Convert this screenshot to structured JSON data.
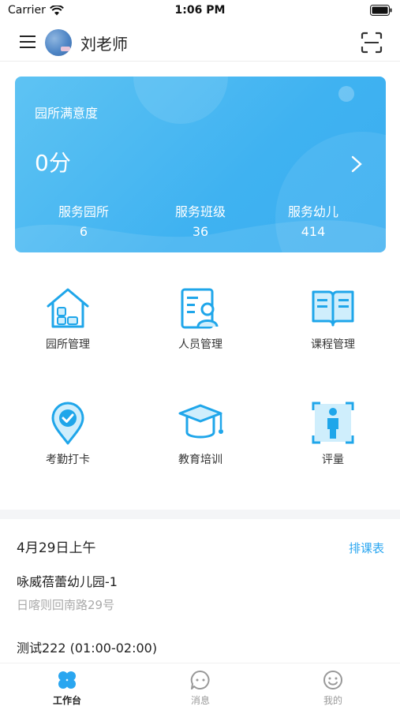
{
  "status_bar": {
    "carrier": "Carrier",
    "time": "1:06 PM"
  },
  "nav": {
    "title": "刘老师",
    "menu_icon": "menu-icon",
    "scan_icon": "scan-icon"
  },
  "satisfaction": {
    "label": "园所满意度",
    "score": "0分",
    "stats": [
      {
        "label": "服务园所",
        "value": "6"
      },
      {
        "label": "服务班级",
        "value": "36"
      },
      {
        "label": "服务幼儿",
        "value": "414"
      }
    ]
  },
  "grid": [
    {
      "label": "园所管理",
      "icon": "kindergarten-icon"
    },
    {
      "label": "人员管理",
      "icon": "staff-icon"
    },
    {
      "label": "课程管理",
      "icon": "course-book-icon"
    },
    {
      "label": "考勤打卡",
      "icon": "attendance-pin-icon"
    },
    {
      "label": "教育培训",
      "icon": "graduation-cap-icon"
    },
    {
      "label": "评量",
      "icon": "assessment-person-icon"
    }
  ],
  "schedule": {
    "date": "4月29日上午",
    "link": "排课表",
    "school": "咏威蓓蕾幼儿园-1",
    "address": "日喀则回南路29号",
    "class": "测试222 (01:00-02:00)"
  },
  "tabs": [
    {
      "label": "工作台",
      "icon": "workbench-icon",
      "active": true
    },
    {
      "label": "消息",
      "icon": "message-icon",
      "active": false
    },
    {
      "label": "我的",
      "icon": "profile-icon",
      "active": false
    }
  ],
  "colors": {
    "accent": "#2aa6f0",
    "card": "#3fb2f1",
    "icon": "#1fa6ea"
  }
}
